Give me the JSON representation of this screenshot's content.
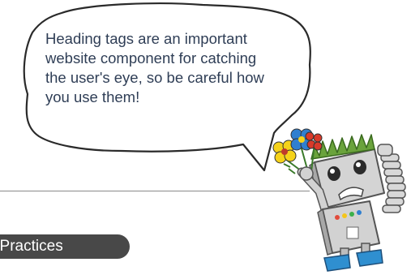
{
  "bubble": {
    "text": "Heading tags are an important website component for catching the user's eye, so be careful how you use them!"
  },
  "section": {
    "label": "t Practices"
  },
  "colors": {
    "bubble_text": "#2f3e56",
    "pill_background": "#484848",
    "robot_body": "#d2d2d2",
    "robot_hair": "#6aa33c",
    "robot_feet": "#2f8fd0"
  }
}
